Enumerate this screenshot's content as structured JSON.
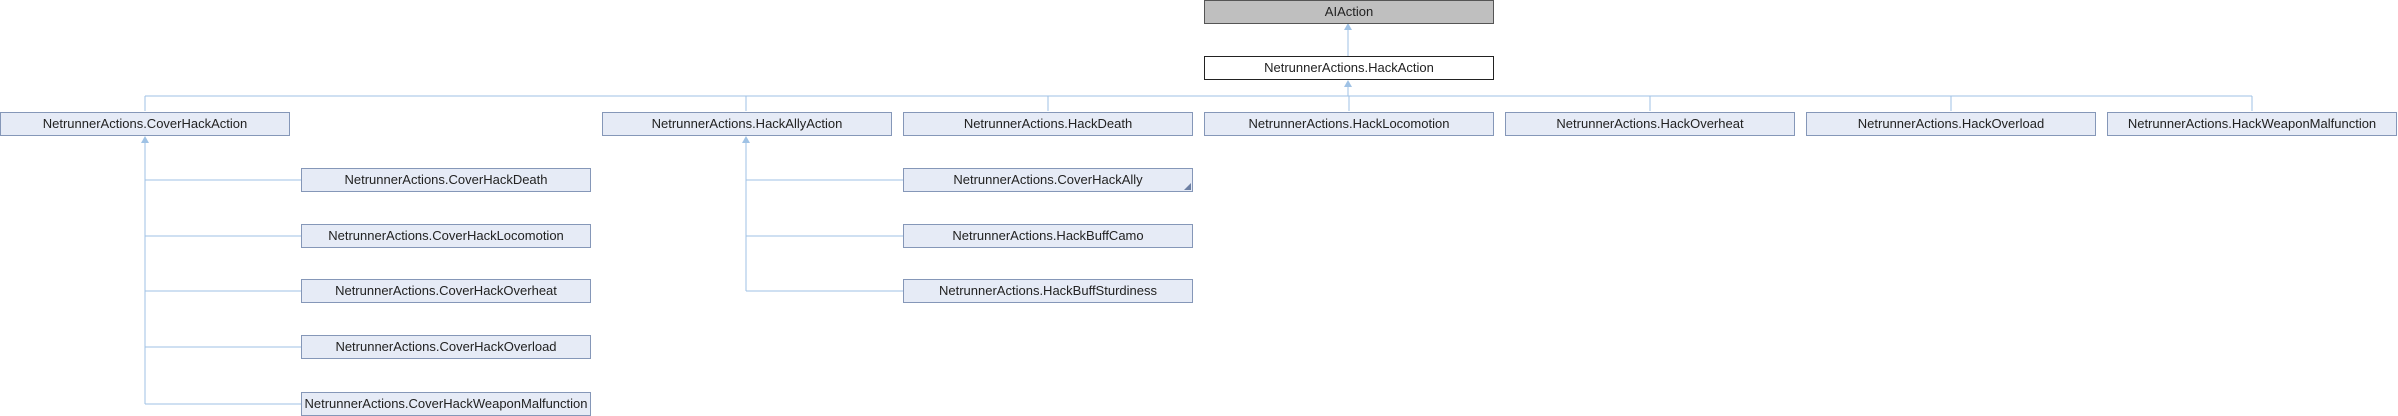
{
  "diagram": {
    "root": {
      "label": "AIAction"
    },
    "current": {
      "label": "NetrunnerActions.HackAction"
    },
    "children": [
      {
        "label": "NetrunnerActions.CoverHackAction"
      },
      {
        "label": "NetrunnerActions.HackAllyAction"
      },
      {
        "label": "NetrunnerActions.HackDeath"
      },
      {
        "label": "NetrunnerActions.HackLocomotion"
      },
      {
        "label": "NetrunnerActions.HackOverheat"
      },
      {
        "label": "NetrunnerActions.HackOverload"
      },
      {
        "label": "NetrunnerActions.HackWeaponMalfunction"
      }
    ],
    "cover_hack_children": [
      {
        "label": "NetrunnerActions.CoverHackDeath"
      },
      {
        "label": "NetrunnerActions.CoverHackLocomotion"
      },
      {
        "label": "NetrunnerActions.CoverHackOverheat"
      },
      {
        "label": "NetrunnerActions.CoverHackOverload"
      },
      {
        "label": "NetrunnerActions.CoverHackWeaponMalfunction"
      }
    ],
    "hack_ally_children": [
      {
        "label": "NetrunnerActions.CoverHackAlly"
      },
      {
        "label": "NetrunnerActions.HackBuffCamo"
      },
      {
        "label": "NetrunnerActions.HackBuffSturdiness"
      }
    ],
    "colors": {
      "node_fill": "#e6ebf6",
      "node_border": "#8597b8",
      "base_fill": "#bfbfbf",
      "current_fill": "#ffffff",
      "connector": "#9fc2e5"
    }
  }
}
